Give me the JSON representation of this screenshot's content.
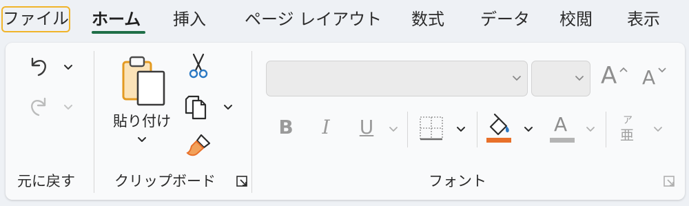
{
  "tabs": [
    {
      "label": "ファイル"
    },
    {
      "label": "ホーム"
    },
    {
      "label": "挿入"
    },
    {
      "label": "ページ レイアウト"
    },
    {
      "label": "数式"
    },
    {
      "label": "データ"
    },
    {
      "label": "校閲"
    },
    {
      "label": "表示"
    }
  ],
  "groups": {
    "undo": {
      "label": "元に戻す"
    },
    "clipboard": {
      "label": "クリップボード",
      "paste_label": "貼り付け"
    },
    "font": {
      "label": "フォント"
    }
  },
  "font_group": {
    "bold": "B",
    "italic": "I",
    "underline": "U",
    "grow": "A",
    "shrink": "A",
    "font_color": "A",
    "phonetic_top": "ア",
    "phonetic_bottom": "亜"
  },
  "colors": {
    "accent_green": "#1e6e47",
    "file_outline": "#f0b429",
    "fill_color_bar": "#e8702a",
    "font_color_bar": "#b4b4b4",
    "scissors_blue": "#2b79c4",
    "brush_orange": "#e8702a"
  }
}
